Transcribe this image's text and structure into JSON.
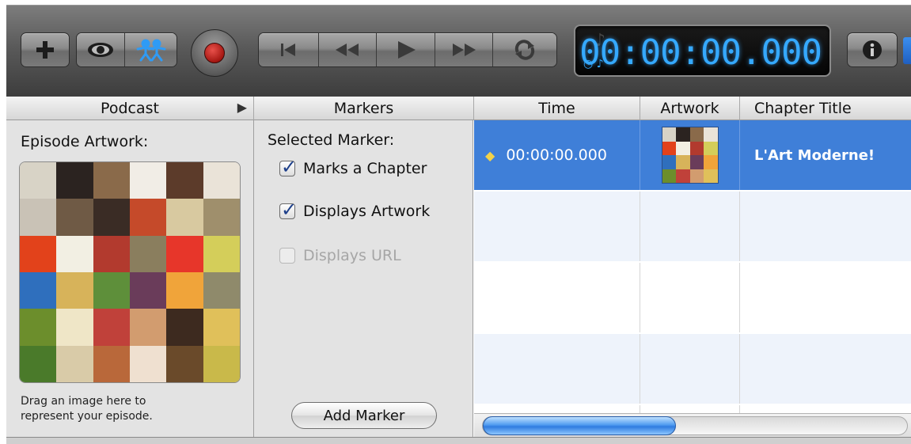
{
  "toolbar": {
    "add_icon": "plus-icon",
    "view_icon": "eye-icon",
    "people_icon": "people-icon",
    "record_icon": "record-icon",
    "transport": [
      "skip-to-start-icon",
      "rewind-icon",
      "play-icon",
      "fast-forward-icon",
      "loop-icon"
    ],
    "lcd_time": "00:00:00.000",
    "info_icon": "info-icon"
  },
  "headers": {
    "podcast": "Podcast",
    "markers": "Markers",
    "time": "Time",
    "artwork": "Artwork",
    "chapter_title": "Chapter Title"
  },
  "podcast_pane": {
    "label": "Episode Artwork:",
    "hint_line1": "Drag an image here to",
    "hint_line2": "represent your episode."
  },
  "markers_pane": {
    "label": "Selected Marker:",
    "checkboxes": [
      {
        "label": "Marks a Chapter",
        "checked": true,
        "enabled": true
      },
      {
        "label": "Displays Artwork",
        "checked": true,
        "enabled": true
      },
      {
        "label": "Displays URL",
        "checked": false,
        "enabled": false
      }
    ],
    "add_button": "Add Marker"
  },
  "markers_table": {
    "rows": [
      {
        "time": "00:00:00.000",
        "chapter_title": "L'Art Moderne!",
        "selected": true
      }
    ]
  },
  "colors": {
    "selection": "#3f7fd8",
    "lcd_text": "#35a9ff",
    "record": "#c0231d"
  }
}
